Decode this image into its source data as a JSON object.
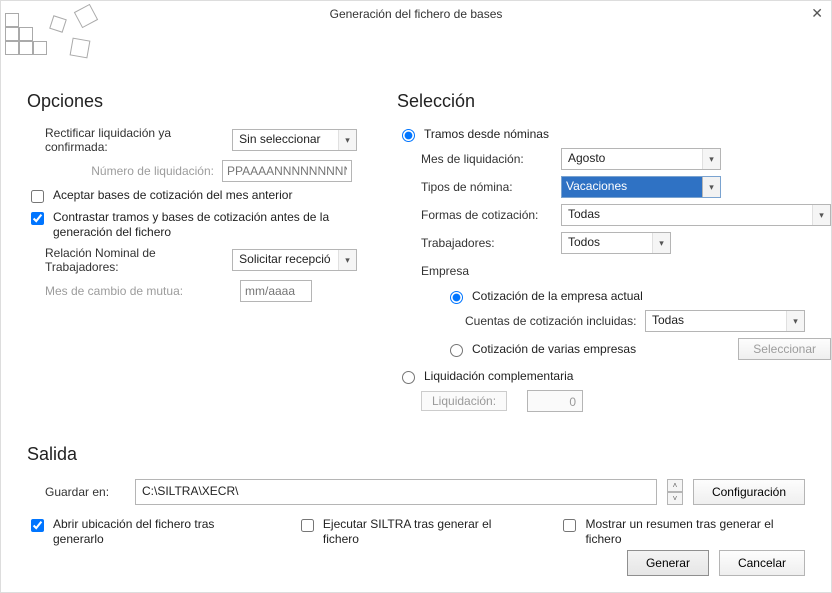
{
  "window": {
    "title": "Generación del fichero de bases",
    "close": "✕"
  },
  "opciones": {
    "heading": "Opciones",
    "rectificar_label": "Rectificar liquidación ya confirmada:",
    "rectificar_value": "Sin seleccionar",
    "num_liquidacion_label": "Número de liquidación:",
    "num_liquidacion_placeholder": "PPAAAANNNNNNNNNDC",
    "aceptar_bases": "Aceptar bases de cotización del mes anterior",
    "contrastar": "Contrastar tramos y bases de cotización antes de la generación del fichero",
    "rel_nominal_label": "Relación Nominal de Trabajadores:",
    "rel_nominal_value": "Solicitar recepció",
    "mes_mutua_label": "Mes de cambio de mutua:",
    "mes_mutua_placeholder": "mm/aaaa"
  },
  "seleccion": {
    "heading": "Selección",
    "tramos_radio": "Tramos desde nóminas",
    "mes_liq_label": "Mes de liquidación:",
    "mes_liq_value": "Agosto",
    "tipos_nomina_label": "Tipos de nómina:",
    "tipos_nomina_value": "Vacaciones",
    "formas_label": "Formas de cotización:",
    "formas_value": "Todas",
    "trabajadores_label": "Trabajadores:",
    "trabajadores_value": "Todos",
    "empresa_label": "Empresa",
    "cot_actual": "Cotización de la empresa actual",
    "cuentas_label": "Cuentas de cotización incluidas:",
    "cuentas_value": "Todas",
    "cot_varias": "Cotización de varias empresas",
    "seleccionar_btn": "Seleccionar",
    "liq_comp_radio": "Liquidación complementaria",
    "liq_label": "Liquidación:",
    "liq_value": "0"
  },
  "salida": {
    "heading": "Salida",
    "guardar_label": "Guardar en:",
    "guardar_value": "C:\\SILTRA\\XECR\\",
    "config_btn": "Configuración",
    "abrir_ubicacion": "Abrir ubicación del fichero tras generarlo",
    "ejecutar_siltra": "Ejecutar SILTRA tras generar el fichero",
    "mostrar_resumen": "Mostrar un resumen tras generar el fichero"
  },
  "actions": {
    "generar": "Generar",
    "cancelar": "Cancelar"
  }
}
